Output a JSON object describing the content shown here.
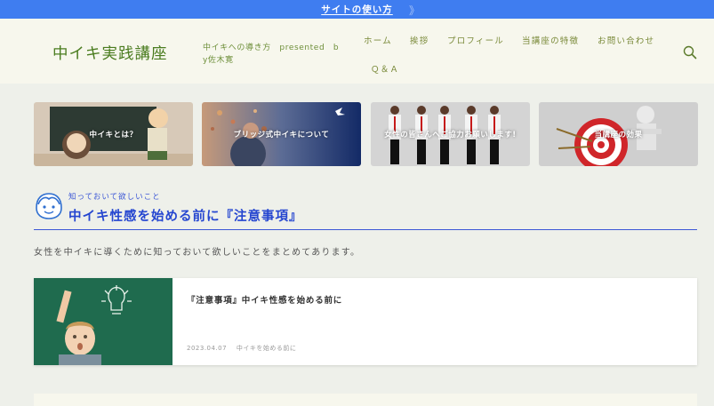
{
  "topbar": {
    "link_label": "サイトの使い方",
    "chevron": "》"
  },
  "header": {
    "logo": "中イキ実践講座",
    "tagline": "中イキへの導き方　presented　by佐木寛",
    "nav": [
      "ホーム",
      "挨拶",
      "プロフィール",
      "当講座の特徴",
      "お問い合わせ",
      "Ｑ＆Ａ"
    ],
    "search_icon": "search-icon"
  },
  "cards": [
    {
      "label": "中イキとは？"
    },
    {
      "label": "ブリッジ式中イキについて"
    },
    {
      "label": "女性の皆さんへご協力お願いします!"
    },
    {
      "label": "当講座の効果"
    }
  ],
  "section": {
    "caption": "知っておいて欲しいこと",
    "title": "中イキ性感を始める前に『注意事項』",
    "intro": "女性を中イキに導くために知っておいて欲しいことをまとめてあります。"
  },
  "post": {
    "title": "『注意事項』中イキ性感を始める前に",
    "date": "2023.04.07",
    "category": "中イキを始める前に"
  },
  "colors": {
    "topbar": "#3f7df0",
    "accent": "#2546d0",
    "logo": "#4a7c1f",
    "header_bg": "#f7f7ed",
    "page_bg": "#eef0ea"
  }
}
